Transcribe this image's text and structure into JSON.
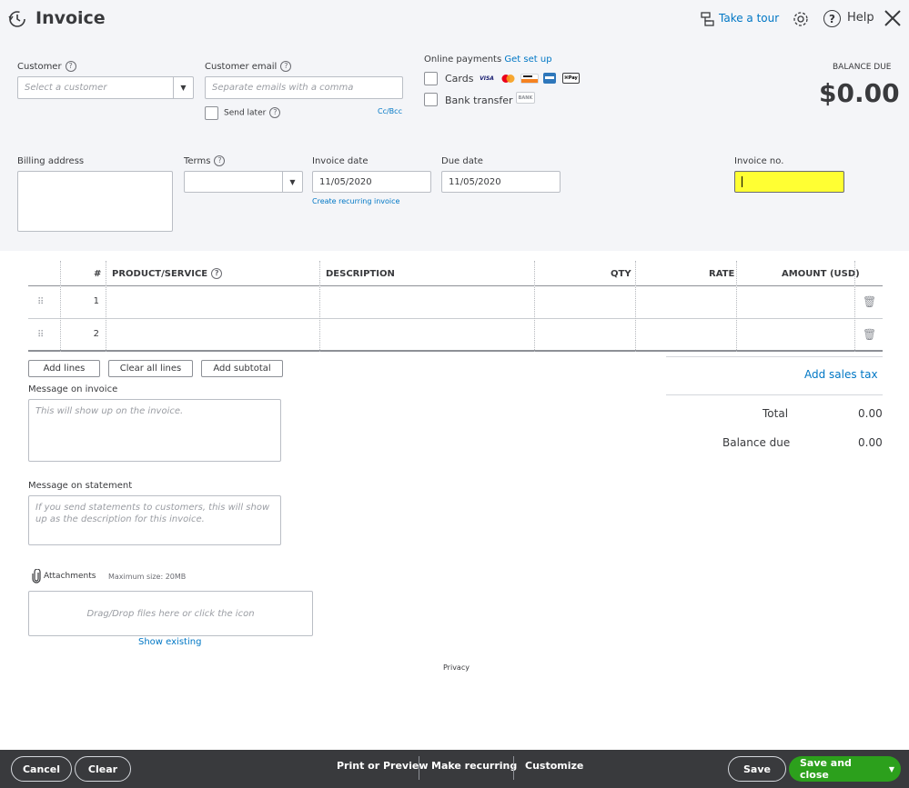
{
  "header": {
    "title": "Invoice",
    "take_tour": "Take a tour",
    "help": "Help"
  },
  "customer": {
    "label": "Customer",
    "placeholder": "Select a customer"
  },
  "email": {
    "label": "Customer email",
    "placeholder": "Separate emails with a comma",
    "send_later": "Send later",
    "cc_bcc": "Cc/Bcc"
  },
  "online_payments": {
    "label": "Online payments",
    "setup_link": "Get set up",
    "cards_label": "Cards",
    "bank_label": "Bank transfer",
    "logos": [
      "VISA",
      "mastercard",
      "DISCOVER",
      "AMEX",
      "Apple Pay",
      "BANK"
    ]
  },
  "balance_due": {
    "label": "BALANCE DUE",
    "amount": "$0.00"
  },
  "billing": {
    "label": "Billing address"
  },
  "terms": {
    "label": "Terms",
    "value": ""
  },
  "invoice_date": {
    "label": "Invoice date",
    "value": "11/05/2020",
    "recurring_link": "Create recurring invoice"
  },
  "due_date": {
    "label": "Due date",
    "value": "11/05/2020"
  },
  "invoice_no": {
    "label": "Invoice no.",
    "value": "",
    "highlight": "#ffff33"
  },
  "table": {
    "headers": {
      "num": "#",
      "product": "PRODUCT/SERVICE",
      "description": "DESCRIPTION",
      "qty": "QTY",
      "rate": "RATE",
      "amount": "AMOUNT (USD)"
    },
    "rows": [
      {
        "num": "1"
      },
      {
        "num": "2"
      }
    ]
  },
  "line_buttons": {
    "add_lines": "Add lines",
    "clear_all": "Clear all lines",
    "add_subtotal": "Add subtotal"
  },
  "message_invoice": {
    "label": "Message on invoice",
    "placeholder": "This will show up on the invoice."
  },
  "message_statement": {
    "label": "Message on statement",
    "placeholder": "If you send statements to customers, this will show up as the description for this invoice."
  },
  "attachments": {
    "label": "Attachments",
    "max_size": "Maximum size: 20MB",
    "drop_text": "Drag/Drop files here or click the icon",
    "show_existing": "Show existing"
  },
  "totals": {
    "add_sales_tax": "Add sales tax",
    "total_label": "Total",
    "total_value": "0.00",
    "balance_label": "Balance due",
    "balance_value": "0.00"
  },
  "privacy": "Privacy",
  "footer": {
    "cancel": "Cancel",
    "clear": "Clear",
    "print_preview": "Print or Preview",
    "make_recurring": "Make recurring",
    "customize": "Customize",
    "save": "Save",
    "save_close": "Save and close"
  },
  "colors": {
    "accent": "#0077c5",
    "primary_green": "#2ca01c",
    "footer_bg": "#393a3d",
    "top_bg": "#f4f5f8"
  }
}
